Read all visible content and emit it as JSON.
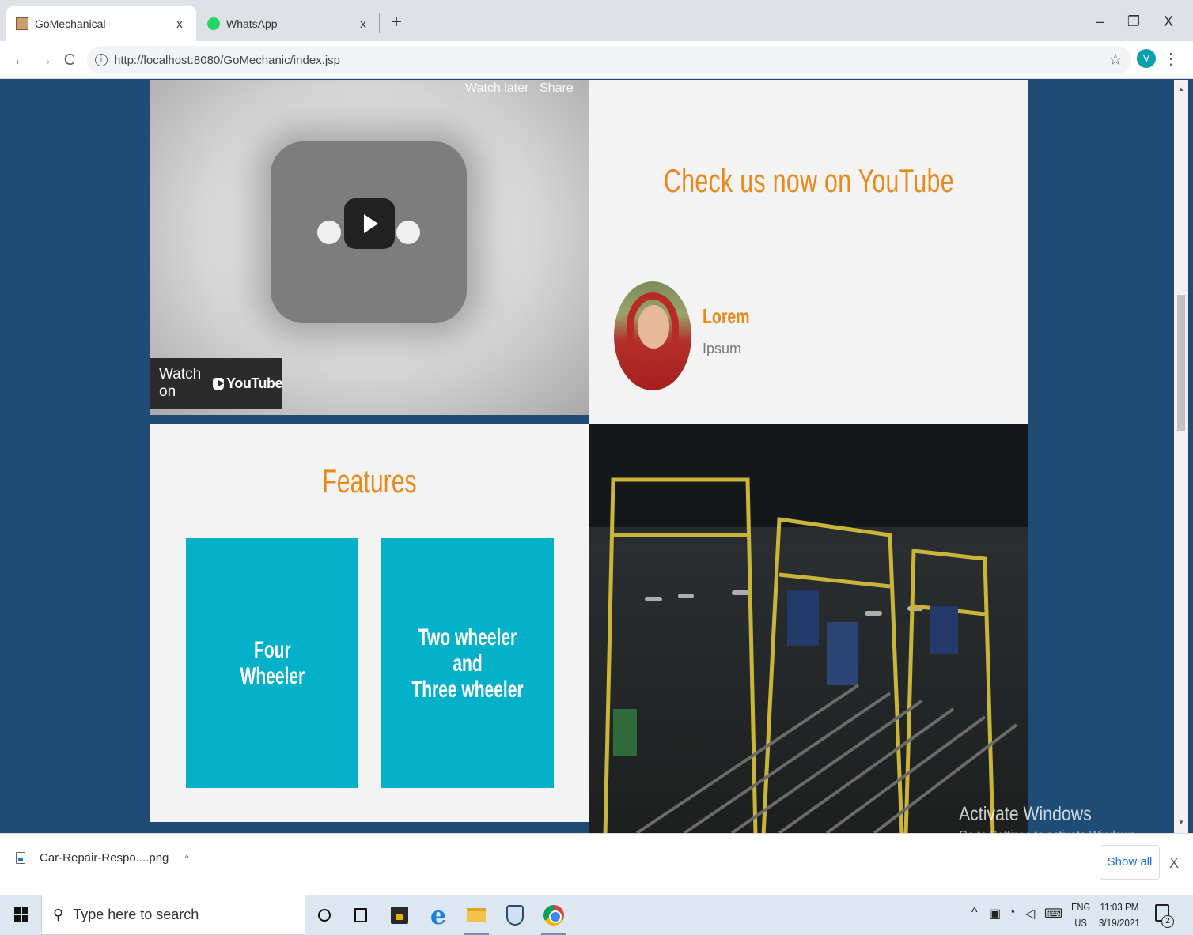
{
  "browser": {
    "tabs": [
      {
        "label": "GoMechanical",
        "close": "x"
      },
      {
        "label": "WhatsApp",
        "close": "x"
      }
    ],
    "new_tab": "+",
    "window": {
      "minimize": "–",
      "maximize": "❐",
      "close": "X"
    },
    "nav": {
      "back": "←",
      "forward": "→",
      "reload": "C"
    },
    "url": "http://localhost:8080/GoMechanic/index.jsp",
    "bookmark_icon": "☆",
    "profile_initial": "V",
    "menu_icon": "⋮"
  },
  "video": {
    "watch_later": "Watch later",
    "share": "Share",
    "watch_on": "Watch on",
    "youtube_logo": "YouTube"
  },
  "promo": {
    "title": "Check us now on YouTube",
    "name": "Lorem",
    "subtitle": "Ipsum"
  },
  "features": {
    "title": "Features",
    "cards": [
      {
        "label": "Four\nWheeler"
      },
      {
        "label": "Two wheeler and\nThree wheeler"
      }
    ]
  },
  "watermark": {
    "line1": "Activate Windows",
    "line2": "Go to Settings to activate Windows."
  },
  "downloads": {
    "file": "Car-Repair-Respo....png",
    "caret": "^",
    "show_all": "Show all",
    "close": "X"
  },
  "taskbar": {
    "search_placeholder": "Type here to search",
    "tray_caret": "^",
    "lang_top": "ENG",
    "lang_bottom": "US",
    "time": "11:03 PM",
    "date": "3/19/2021",
    "notifications": "2"
  },
  "colors": {
    "page_bg": "#1f4c75",
    "accent_orange": "#e8891a",
    "card_teal": "#04b1c8",
    "panel": "#f3f3f3"
  }
}
